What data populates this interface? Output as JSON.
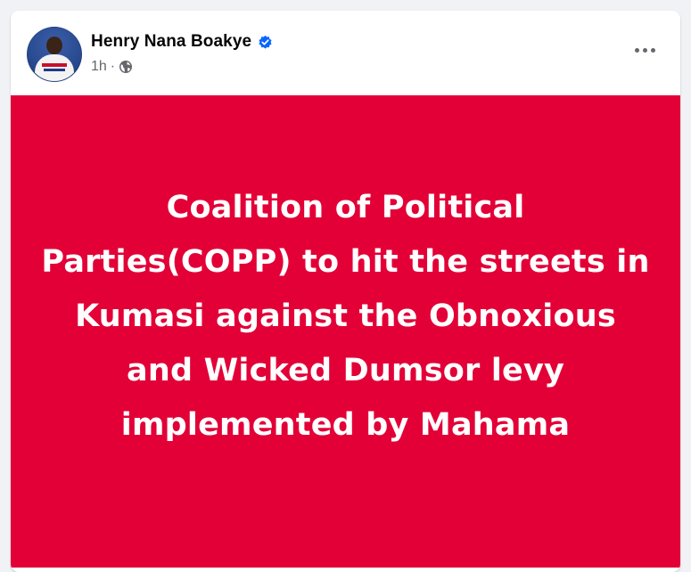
{
  "post": {
    "author": {
      "name": "Henry Nana Boakye",
      "verified": true,
      "avatar_icon": "profile-photo"
    },
    "meta": {
      "time": "1h",
      "separator": "·",
      "audience_icon": "globe-icon"
    },
    "more_icon": "more-options-icon",
    "image_text": "Coalition of Political Parties(COPP) to hit the streets in Kumasi against the Obnoxious and Wicked Dumsor levy implemented by Mahama",
    "image_background": "#e20037"
  },
  "colors": {
    "verified_badge": "#0866ff",
    "secondary_text": "#65676b",
    "primary_text": "#050505"
  }
}
